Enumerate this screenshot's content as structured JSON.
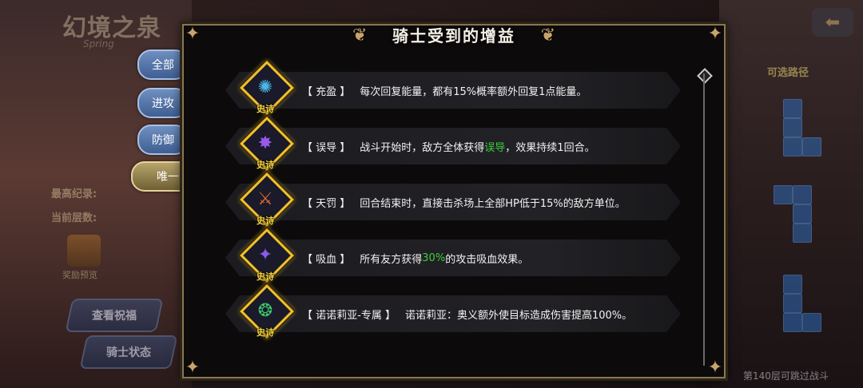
{
  "background": {
    "logo_text": "幻境之泉",
    "logo_sub": "Spring",
    "record_label": "最高纪录:",
    "current_label": "当前层数:",
    "reward_label": "奖励预览",
    "view_button": "查看祝福",
    "status_button": "骑士状态",
    "route_label": "可选路径",
    "floor_tip": "第140层可跳过战斗",
    "back_icon": "arrow-left-icon"
  },
  "tabs": [
    {
      "label": "全部"
    },
    {
      "label": "进攻"
    },
    {
      "label": "防御"
    },
    {
      "label": "唯一",
      "active": true
    }
  ],
  "modal": {
    "title": "骑士受到的增益",
    "buffs": [
      {
        "name": "【 充盈 】",
        "desc_before": "每次回复能量，都有15%概率额外回复1点能量。",
        "highlight": "",
        "desc_after": "",
        "rarity": "史诗",
        "icon": "orb-swirl-icon",
        "icon_color": "#4ab8e8"
      },
      {
        "name": "【 误导 】",
        "desc_before": "战斗开始时，敌方全体获得",
        "highlight": "误导",
        "desc_after": "，效果持续1回合。",
        "rarity": "史诗",
        "icon": "spikes-icon",
        "icon_color": "#9a5ae8"
      },
      {
        "name": "【 天罚 】",
        "desc_before": "回合结束时，直接击杀场上全部HP低于15%的敌方单位。",
        "highlight": "",
        "desc_after": "",
        "rarity": "史诗",
        "icon": "blades-icon",
        "icon_color": "#e86a2a"
      },
      {
        "name": "【 吸血 】",
        "desc_before": "所有友方获得",
        "highlight": "30%",
        "desc_after": "的攻击吸血效果。",
        "rarity": "史诗",
        "icon": "dagger-icon",
        "icon_color": "#8a5ae8"
      },
      {
        "name": "【 诺诺莉亚-专属 】",
        "desc_before": "诺诺莉亚：奥义额外使目标造成伤害提高100%。",
        "highlight": "",
        "desc_after": "",
        "rarity": "史诗",
        "icon": "vortex-icon",
        "icon_color": "#3ac86a"
      }
    ]
  },
  "colors": {
    "accent_gold": "#f0c02a",
    "highlight_green": "#3fcf3a",
    "frame": "#8a7650"
  }
}
